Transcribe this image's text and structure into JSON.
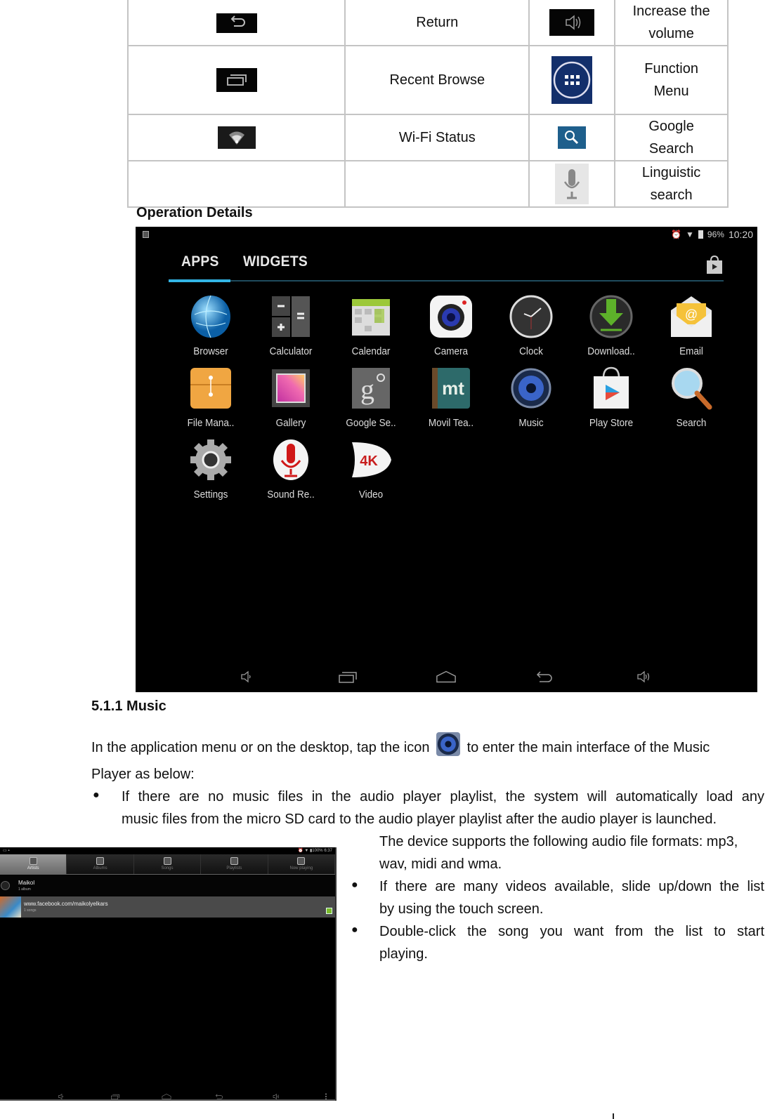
{
  "icon_table": {
    "rows": [
      {
        "left_icon": "return-icon",
        "left_label": "Return",
        "right_icon": "volume-up-icon",
        "right_label_lines": [
          "Increase the",
          "volume"
        ]
      },
      {
        "left_icon": "recent-apps-icon",
        "left_label": "Recent Browse",
        "right_icon": "app-menu-icon",
        "right_label_lines": [
          "Function",
          "Menu"
        ]
      },
      {
        "left_icon": "wifi-icon",
        "left_label": "Wi-Fi Status",
        "right_icon": "google-search-icon",
        "right_label_lines": [
          "Google",
          "Search"
        ]
      },
      {
        "left_icon": "",
        "left_label": "",
        "right_icon": "microphone-icon",
        "right_label_lines": [
          "Linguistic",
          "search"
        ]
      }
    ]
  },
  "operation_details": {
    "heading": "Operation Details",
    "screenshot": {
      "status_bar": {
        "battery": "96%",
        "time": "10:20"
      },
      "tabs": [
        {
          "label": "APPS",
          "active": true
        },
        {
          "label": "WIDGETS",
          "active": false
        }
      ],
      "accent_color": "#33b5e5",
      "apps": [
        {
          "label": "Browser",
          "icon": "globe-icon"
        },
        {
          "label": "Calculator",
          "icon": "calculator-icon"
        },
        {
          "label": "Calendar",
          "icon": "calendar-icon"
        },
        {
          "label": "Camera",
          "icon": "camera-icon"
        },
        {
          "label": "Clock",
          "icon": "clock-icon"
        },
        {
          "label": "Download..",
          "icon": "download-icon"
        },
        {
          "label": "Email",
          "icon": "email-icon"
        },
        {
          "label": "File Mana..",
          "icon": "file-manager-icon"
        },
        {
          "label": "Gallery",
          "icon": "gallery-icon"
        },
        {
          "label": "Google Se..",
          "icon": "google-settings-icon"
        },
        {
          "label": "Movil Tea..",
          "icon": "movil-tea-icon"
        },
        {
          "label": "Music",
          "icon": "speaker-icon"
        },
        {
          "label": "Play Store",
          "icon": "play-store-icon"
        },
        {
          "label": "Search",
          "icon": "magnifier-icon"
        },
        {
          "label": "Settings",
          "icon": "gear-icon"
        },
        {
          "label": "Sound Re..",
          "icon": "sound-recorder-icon"
        },
        {
          "label": "Video",
          "icon": "video-4k-icon"
        }
      ],
      "nav_buttons": [
        "volume-down-icon",
        "recent-apps-icon",
        "home-icon",
        "back-icon",
        "volume-up-icon"
      ]
    }
  },
  "music_section": {
    "title": "5.1.1 Music",
    "intro_before_icon": "In the application menu or on the desktop, tap the icon",
    "intro_after_icon": "to enter the main interface of the Music",
    "intro_line2": "Player as below:",
    "bullets": [
      {
        "lines": [
          "If there are no music files in the audio player playlist, the system will automatically load any",
          "music files from the micro SD card to the audio player playlist after the audio player is launched.",
          "The device supports the following audio file formats: mp3,",
          "wav, midi and wma."
        ]
      },
      {
        "lines": [
          "If there are many videos available, slide up/down the list",
          "by using the touch screen."
        ]
      },
      {
        "lines": [
          "Double-click the song you want from the list to start",
          "playing."
        ]
      }
    ],
    "player_screenshot": {
      "status_bar": {
        "battery": "100%",
        "time": "6:37"
      },
      "tabs": [
        {
          "label": "Artists",
          "active": true
        },
        {
          "label": "Albums",
          "active": false
        },
        {
          "label": "Songs",
          "active": false
        },
        {
          "label": "Playlists",
          "active": false
        },
        {
          "label": "Now playing",
          "active": false
        }
      ],
      "list": [
        {
          "title": "Maikol",
          "subtitle": "1 album"
        },
        {
          "title": "www.facebook.com/maikolyelkars",
          "subtitle": "1 songs"
        }
      ]
    }
  }
}
